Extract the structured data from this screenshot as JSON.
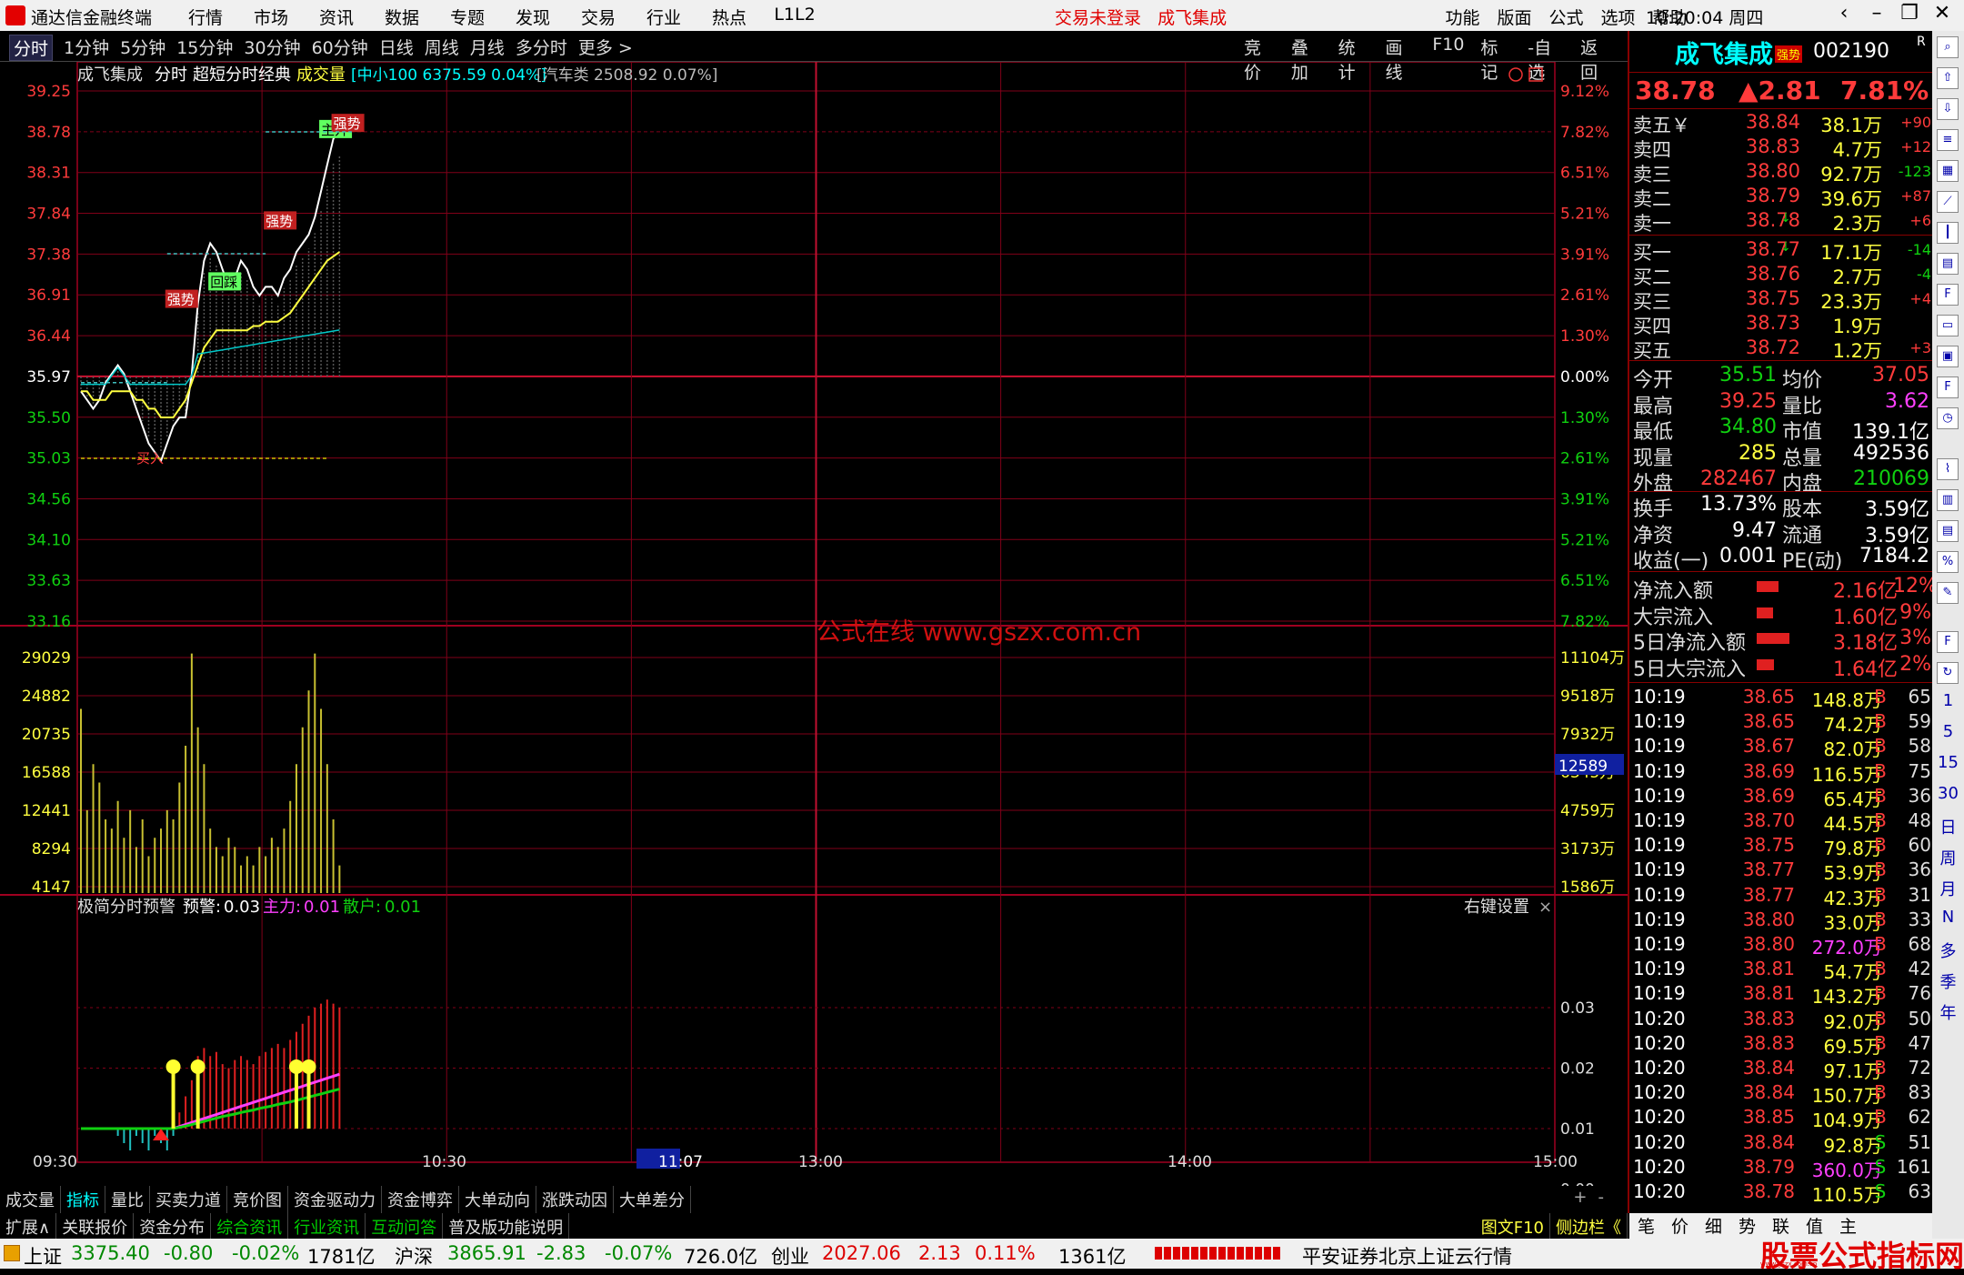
{
  "app": {
    "name": "通达信金融终端",
    "menus": [
      "行情",
      "市场",
      "资讯",
      "数据",
      "专题",
      "发现",
      "交易",
      "行业",
      "热点",
      "L1L2"
    ],
    "notice": "交易未登录",
    "notice_stock": "成飞集成",
    "right_menus": [
      "功能",
      "版面",
      "公式",
      "选项",
      "帮助"
    ],
    "time": "10:20:04",
    "weekday": "周四"
  },
  "toolbar": {
    "periods": [
      "分时",
      "1分钟",
      "5分钟",
      "15分钟",
      "30分钟",
      "60分钟",
      "日线",
      "周线",
      "月线",
      "多分时",
      "更多 >"
    ],
    "active_period": "分时",
    "right_items": [
      "竞价",
      "叠加",
      "统计",
      "画线",
      "F10",
      "标记",
      "-自选",
      "返回"
    ]
  },
  "chart_header": {
    "stock": "成飞集成",
    "mode": "分时",
    "template": "超短分时经典",
    "indicator": "成交量",
    "index_info": "[中小100 6375.59 0.04%]",
    "sector_info": "[汽车类 2508.92 0.07%]"
  },
  "watermark": "公式在线 www.gszx.com.cn",
  "brand": "股票公式指标网",
  "brand_url": "www.gszx.com.cn",
  "price_axis": {
    "left": [
      "39.25",
      "38.78",
      "38.31",
      "37.84",
      "37.38",
      "36.91",
      "36.44",
      "35.97",
      "35.50",
      "35.03",
      "34.56",
      "34.10",
      "33.63",
      "33.16"
    ],
    "right": [
      "9.12%",
      "7.82%",
      "6.51%",
      "5.21%",
      "3.91%",
      "2.61%",
      "1.30%",
      "0.00%",
      "1.30%",
      "2.61%",
      "3.91%",
      "5.21%",
      "6.51%",
      "7.82%"
    ]
  },
  "volume_axis": {
    "left": [
      "29029",
      "24882",
      "20735",
      "16588",
      "12441",
      "8294",
      "4147"
    ],
    "right": [
      "11104万",
      "9518万",
      "7932万",
      "6345万",
      "4759万",
      "3173万",
      "1586万"
    ],
    "cursor_value": "12589"
  },
  "time_axis": [
    "09:30",
    "10:30",
    "11:07",
    "13:00",
    "14:00",
    "15:00"
  ],
  "signal_labels": [
    "买入",
    "回踩",
    "强势",
    "主升",
    "强势"
  ],
  "indicator_panel": {
    "name": "极简分时预警",
    "warn_label": "预警:",
    "warn_value": "0.03",
    "main_label": "主力:",
    "main_value": "0.01",
    "retail_label": "散户:",
    "retail_value": "0.01",
    "settings": "右键设置",
    "close": "×",
    "axis": [
      "0.03",
      "0.02",
      "0.01",
      "0.00"
    ]
  },
  "bottom_tabs": [
    "成交量",
    "指标",
    "量比",
    "买卖力道",
    "竞价图",
    "资金驱动力",
    "资金博弈",
    "大单动向",
    "涨跌动因",
    "大单差分"
  ],
  "bottom_tabs_active": "指标",
  "bottom_controls": [
    "+",
    "-"
  ],
  "ext_bar": [
    "扩展∧",
    "关联报价",
    "资金分布",
    "综合资讯",
    "行业资讯",
    "互动问答",
    "普及版功能说明"
  ],
  "ext_bar_right": [
    "图文F10",
    "侧边栏《",
    "笔",
    "价",
    "细",
    "势",
    "联",
    "值",
    "主"
  ],
  "quote": {
    "name": "成飞集成",
    "tag": "强势",
    "code": "002190",
    "r": "R",
    "last": "38.78",
    "change": "▲2.81",
    "pct": "7.81%"
  },
  "orderbook": {
    "asks": [
      {
        "label": "卖五￥",
        "price": "38.84",
        "vol": "38.1万",
        "chg": "+90",
        "arrow": ""
      },
      {
        "label": "卖四",
        "price": "38.83",
        "vol": "4.7万",
        "chg": "+12",
        "arrow": ""
      },
      {
        "label": "卖三",
        "price": "38.80",
        "vol": "92.7万",
        "chg": "-123",
        "arrow": ""
      },
      {
        "label": "卖二",
        "price": "38.79",
        "vol": "39.6万",
        "chg": "+87",
        "arrow": ""
      },
      {
        "label": "卖一",
        "price": "38.78",
        "vol": "2.3万",
        "chg": "+6",
        "arrow": "↓"
      }
    ],
    "bids": [
      {
        "label": "买一",
        "price": "38.77",
        "vol": "17.1万",
        "chg": "-14",
        "arrow": "↓"
      },
      {
        "label": "买二",
        "price": "38.76",
        "vol": "2.7万",
        "chg": "-4",
        "arrow": ""
      },
      {
        "label": "买三",
        "price": "38.75",
        "vol": "23.3万",
        "chg": "+4",
        "arrow": ""
      },
      {
        "label": "买四",
        "price": "38.73",
        "vol": "1.9万",
        "chg": "",
        "arrow": ""
      },
      {
        "label": "买五",
        "price": "38.72",
        "vol": "1.2万",
        "chg": "+3",
        "arrow": ""
      }
    ]
  },
  "stats": [
    {
      "l1": "今开",
      "v1": "35.51",
      "c1": "green",
      "l2": "均价",
      "v2": "37.05",
      "c2": "red"
    },
    {
      "l1": "最高",
      "v1": "39.25",
      "c1": "red",
      "l2": "量比",
      "v2": "3.62",
      "c2": "mag"
    },
    {
      "l1": "最低",
      "v1": "34.80",
      "c1": "green",
      "l2": "市值",
      "v2": "139.1亿",
      "c2": "wht"
    },
    {
      "l1": "现量",
      "v1": "285",
      "c1": "yel",
      "l2": "总量",
      "v2": "492536",
      "c2": "wht"
    },
    {
      "l1": "外盘",
      "v1": "282467",
      "c1": "red",
      "l2": "内盘",
      "v2": "210069",
      "c2": "green"
    },
    {
      "l1": "换手",
      "v1": "13.73%",
      "c1": "wht",
      "l2": "股本",
      "v2": "3.59亿",
      "c2": "wht"
    },
    {
      "l1": "净资",
      "v1": "9.47",
      "c1": "wht",
      "l2": "流通",
      "v2": "3.59亿",
      "c2": "wht"
    },
    {
      "l1": "收益(一)",
      "v1": "0.001",
      "c1": "wht",
      "l2": "PE(动)",
      "v2": "7184.2",
      "c2": "wht"
    }
  ],
  "flows": [
    {
      "label": "净流入额",
      "value": "2.16亿",
      "pct": "12%",
      "bar": 0.5
    },
    {
      "label": "大宗流入",
      "value": "1.60亿",
      "pct": "9%",
      "bar": 0.38
    },
    {
      "label": "5日净流入额",
      "value": "3.18亿",
      "pct": "3%",
      "bar": 0.75
    },
    {
      "label": "5日大宗流入",
      "value": "1.64亿",
      "pct": "2%",
      "bar": 0.4
    }
  ],
  "ticks": [
    {
      "t": "10:19",
      "p": "38.65",
      "v": "148.8万",
      "d": "B",
      "n": "65",
      "pc": "red",
      "vc": "yel"
    },
    {
      "t": "10:19",
      "p": "38.65",
      "v": "74.2万",
      "d": "B",
      "n": "59",
      "pc": "red",
      "vc": "yel"
    },
    {
      "t": "10:19",
      "p": "38.67",
      "v": "82.0万",
      "d": "B",
      "n": "58",
      "pc": "red",
      "vc": "yel"
    },
    {
      "t": "10:19",
      "p": "38.69",
      "v": "116.5万",
      "d": "B",
      "n": "75",
      "pc": "red",
      "vc": "yel"
    },
    {
      "t": "10:19",
      "p": "38.69",
      "v": "65.4万",
      "d": "B",
      "n": "36",
      "pc": "red",
      "vc": "yel"
    },
    {
      "t": "10:19",
      "p": "38.70",
      "v": "44.5万",
      "d": "B",
      "n": "48",
      "pc": "red",
      "vc": "yel"
    },
    {
      "t": "10:19",
      "p": "38.75",
      "v": "79.8万",
      "d": "B",
      "n": "60",
      "pc": "red",
      "vc": "yel"
    },
    {
      "t": "10:19",
      "p": "38.77",
      "v": "53.9万",
      "d": "B",
      "n": "36",
      "pc": "red",
      "vc": "yel"
    },
    {
      "t": "10:19",
      "p": "38.77",
      "v": "42.3万",
      "d": "B",
      "n": "31",
      "pc": "red",
      "vc": "yel"
    },
    {
      "t": "10:19",
      "p": "38.80",
      "v": "33.0万",
      "d": "B",
      "n": "33",
      "pc": "red",
      "vc": "yel"
    },
    {
      "t": "10:19",
      "p": "38.80",
      "v": "272.0万",
      "d": "B",
      "n": "68",
      "pc": "red",
      "vc": "mag"
    },
    {
      "t": "10:19",
      "p": "38.81",
      "v": "54.7万",
      "d": "B",
      "n": "42",
      "pc": "red",
      "vc": "yel"
    },
    {
      "t": "10:19",
      "p": "38.81",
      "v": "143.2万",
      "d": "B",
      "n": "76",
      "pc": "red",
      "vc": "yel"
    },
    {
      "t": "10:20",
      "p": "38.83",
      "v": "92.0万",
      "d": "B",
      "n": "50",
      "pc": "red",
      "vc": "yel"
    },
    {
      "t": "10:20",
      "p": "38.83",
      "v": "69.5万",
      "d": "B",
      "n": "47",
      "pc": "red",
      "vc": "yel"
    },
    {
      "t": "10:20",
      "p": "38.84",
      "v": "97.1万",
      "d": "B",
      "n": "72",
      "pc": "red",
      "vc": "yel"
    },
    {
      "t": "10:20",
      "p": "38.84",
      "v": "150.7万",
      "d": "B",
      "n": "83",
      "pc": "red",
      "vc": "yel"
    },
    {
      "t": "10:20",
      "p": "38.85",
      "v": "104.9万",
      "d": "B",
      "n": "62",
      "pc": "red",
      "vc": "yel"
    },
    {
      "t": "10:20",
      "p": "38.84",
      "v": "92.8万",
      "d": "S",
      "n": "51",
      "pc": "red",
      "vc": "yel"
    },
    {
      "t": "10:20",
      "p": "38.79",
      "v": "360.0万",
      "d": "S",
      "n": "161",
      "pc": "red",
      "vc": "mag"
    },
    {
      "t": "10:20",
      "p": "38.78",
      "v": "110.5万",
      "d": "S",
      "n": "63",
      "pc": "red",
      "vc": "yel"
    }
  ],
  "side_icons_text": [
    "1",
    "5",
    "15",
    "30",
    "日",
    "周",
    "月",
    "N",
    "多",
    "季",
    "年"
  ],
  "status": {
    "idx1_name": "上证",
    "idx1_val": "3375.40",
    "idx1_chg": "-0.80",
    "idx1_pct": "-0.02%",
    "idx1_amt": "1781亿",
    "idx2_name": "沪深",
    "idx2_val": "3865.91",
    "idx2_chg": "-2.83",
    "idx2_pct": "-0.07%",
    "idx2_amt": "726.0亿",
    "idx3_name": "创业",
    "idx3_val": "2027.06",
    "idx3_chg": "2.13",
    "idx3_pct": "0.11%",
    "idx3_amt": "1361亿",
    "source": "平安证券北京上证云行情"
  },
  "chart_data": [
    {
      "type": "line",
      "title": "成飞集成 分时",
      "x_range": [
        "09:30",
        "15:00"
      ],
      "ylim": [
        33.16,
        39.25
      ],
      "prev_close": 35.97,
      "series": [
        {
          "name": "price",
          "color": "#ffffff",
          "values": [
            35.8,
            35.7,
            35.6,
            35.7,
            35.9,
            36.0,
            36.1,
            36.0,
            35.8,
            35.6,
            35.4,
            35.2,
            35.1,
            35.0,
            35.2,
            35.4,
            35.5,
            35.5,
            36.0,
            36.8,
            37.3,
            37.5,
            37.4,
            37.2,
            37.0,
            37.1,
            37.3,
            37.2,
            37.0,
            36.9,
            37.0,
            37.0,
            36.9,
            37.1,
            37.2,
            37.4,
            37.5,
            37.6,
            37.8,
            38.1,
            38.4,
            38.7,
            38.8
          ]
        },
        {
          "name": "avg",
          "color": "#ffff40",
          "values": [
            35.8,
            35.8,
            35.7,
            35.7,
            35.7,
            35.8,
            35.8,
            35.8,
            35.8,
            35.7,
            35.7,
            35.6,
            35.6,
            35.5,
            35.5,
            35.5,
            35.6,
            35.7,
            35.9,
            36.1,
            36.3,
            36.4,
            36.5,
            36.5,
            36.5,
            36.5,
            36.5,
            36.5,
            36.55,
            36.55,
            36.6,
            36.6,
            36.6,
            36.65,
            36.7,
            36.8,
            36.9,
            37.0,
            37.1,
            37.2,
            37.3,
            37.35,
            37.4
          ]
        }
      ]
    },
    {
      "type": "bar",
      "title": "成交量",
      "ylim": [
        0,
        29029
      ],
      "values": [
        20000,
        9000,
        14000,
        12000,
        8000,
        7000,
        10000,
        6000,
        9000,
        5000,
        8000,
        4000,
        6000,
        7000,
        9000,
        8000,
        12000,
        16000,
        26000,
        18000,
        14000,
        7000,
        5000,
        4000,
        6000,
        5000,
        3000,
        4000,
        3000,
        5000,
        4000,
        6000,
        5000,
        7000,
        10000,
        14000,
        18000,
        22000,
        26000,
        20000,
        14000,
        8000,
        3000
      ]
    },
    {
      "type": "bar",
      "title": "极简分时预警",
      "ylim": [
        0,
        0.035
      ],
      "values": [
        0,
        0,
        0,
        0,
        0,
        0,
        0,
        0,
        0,
        0,
        0,
        0,
        0,
        0,
        0,
        0,
        0.004,
        0.008,
        0.012,
        0.018,
        0.02,
        0.018,
        0.019,
        0.016,
        0.015,
        0.017,
        0.018,
        0.017,
        0.016,
        0.018,
        0.019,
        0.02,
        0.021,
        0.02,
        0.022,
        0.024,
        0.026,
        0.028,
        0.03,
        0.031,
        0.032,
        0.031,
        0.03
      ],
      "series": [
        {
          "name": "主力",
          "color": "#ff40ff",
          "values": [
            0,
            0,
            0,
            0,
            0,
            0,
            0,
            0,
            0,
            0,
            0,
            0,
            0,
            0,
            0,
            0,
            0.0005,
            0.001,
            0.0015,
            0.002,
            0.0025,
            0.003,
            0.0035,
            0.004,
            0.0045,
            0.005,
            0.0055,
            0.006,
            0.0065,
            0.007,
            0.0075,
            0.008,
            0.0085,
            0.009,
            0.0095,
            0.01,
            0.0105,
            0.011,
            0.0115,
            0.012,
            0.0125,
            0.013,
            0.0135
          ]
        },
        {
          "name": "散户",
          "color": "#10d010",
          "values": [
            0,
            0,
            0,
            0,
            0,
            0,
            0,
            0,
            0,
            0,
            0,
            0,
            0,
            0,
            0,
            0,
            0.0003,
            0.0006,
            0.001,
            0.0014,
            0.0018,
            0.0022,
            0.0026,
            0.003,
            0.0033,
            0.0036,
            0.004,
            0.0043,
            0.0046,
            0.005,
            0.0053,
            0.0056,
            0.006,
            0.0063,
            0.0066,
            0.007,
            0.0074,
            0.0078,
            0.0082,
            0.0086,
            0.009,
            0.0094,
            0.0098
          ]
        }
      ]
    }
  ]
}
